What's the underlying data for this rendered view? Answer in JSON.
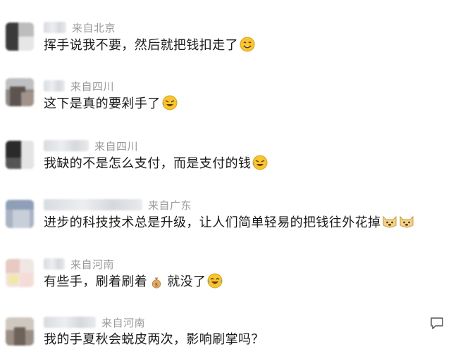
{
  "comments": [
    {
      "location": "来自北京",
      "text": "挥手说我不要，然后就把钱扣走了",
      "emojis": [
        "smile-icon"
      ]
    },
    {
      "location": "来自四川",
      "text": "这下是真的要剁手了",
      "emojis": [
        "laugh-cry-icon"
      ]
    },
    {
      "location": "来自四川",
      "text": "我缺的不是怎么支付，而是支付的钱",
      "emojis": [
        "laugh-cry-icon"
      ]
    },
    {
      "location": "来自广东",
      "text": "进步的科技技术总是升级，让人们简单轻易的把钱往外花掉",
      "emojis": [
        "doge-icon",
        "doge-icon"
      ]
    },
    {
      "location": "来自河南",
      "text_before": "有些手，刷着刷着",
      "text_after": "就没了",
      "emojis": [
        "money-bag-icon",
        "tears-of-joy-icon"
      ]
    },
    {
      "location": "来自河南",
      "text": "我的手夏秋会蜕皮两次，影响刷掌吗？",
      "emojis": []
    }
  ],
  "icons": {
    "reply": "comment-reply-icon"
  },
  "colors": {
    "text": "#1a1a1a",
    "location": "#9a9a9a",
    "emoji_yellow": "#f7c531"
  }
}
